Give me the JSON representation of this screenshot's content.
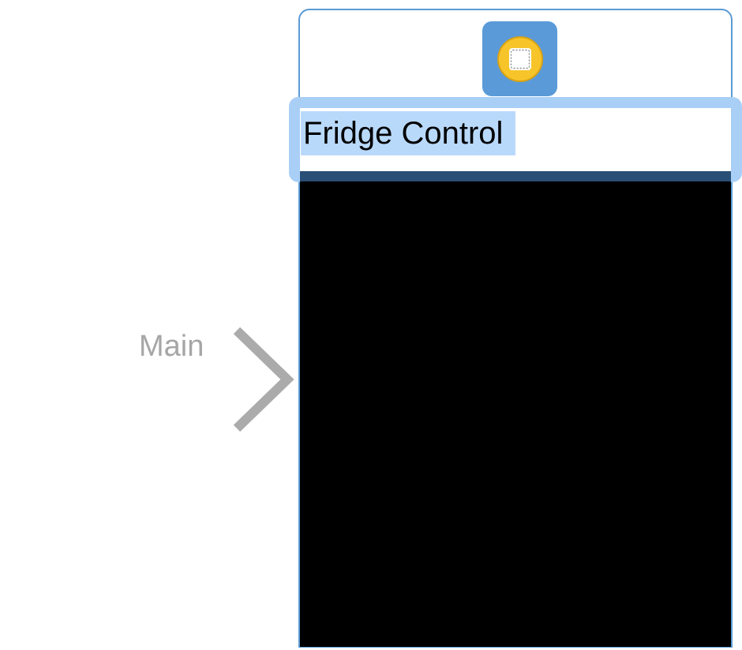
{
  "entry_point": {
    "label": "Main"
  },
  "scene": {
    "dock_icon": "interface-controller-icon",
    "title": "Fridge Control"
  },
  "colors": {
    "scene_border": "#5b9bd5",
    "selection_highlight": "#a9cff6",
    "dock_icon_bg": "#5a9ad8",
    "icon_yellow": "#f7c52a",
    "content_bg": "#000000",
    "arrow_gray": "#a6a6a6"
  }
}
